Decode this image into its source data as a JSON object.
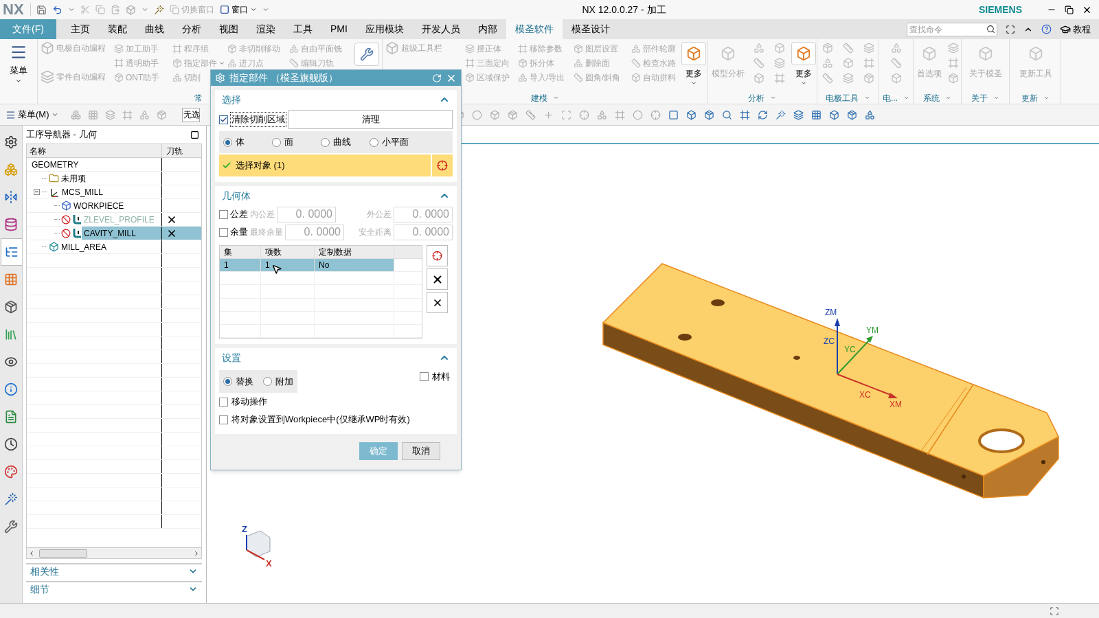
{
  "title_bar": {
    "logo": "NX",
    "switch_window": "切换窗口",
    "window_menu": "窗口",
    "title": "NX 12.0.0.27 - 加工",
    "brand": "SIEMENS"
  },
  "menu_tabs": {
    "file": "文件(F)",
    "tabs": [
      {
        "label": "主页",
        "selected": false
      },
      {
        "label": "装配",
        "selected": false
      },
      {
        "label": "曲线",
        "selected": false
      },
      {
        "label": "分析",
        "selected": false
      },
      {
        "label": "视图",
        "selected": false
      },
      {
        "label": "渲染",
        "selected": false
      },
      {
        "label": "工具",
        "selected": false
      },
      {
        "label": "PMI",
        "selected": false
      },
      {
        "label": "应用模块",
        "selected": false
      },
      {
        "label": "开发人员",
        "selected": false
      },
      {
        "label": "内部",
        "selected": false
      },
      {
        "label": "模圣软件",
        "selected": true
      },
      {
        "label": "模圣设计",
        "selected": false
      }
    ],
    "search_placeholder": "查找命令",
    "tutorial": "教程"
  },
  "ribbon": {
    "menu_button": "菜单",
    "groups": [
      {
        "label": "常",
        "columns": [
          {
            "kind": "medium",
            "items": [
              {
                "label": "电极自动编程",
                "dropdown": false
              },
              {
                "label": "零件自动编程",
                "dropdown": false
              }
            ]
          },
          {
            "kind": "small",
            "items": [
              {
                "label": "加工助手",
                "dropdown": false
              },
              {
                "label": "透明助手",
                "dropdown": false
              },
              {
                "label": "ONT助手",
                "dropdown": false
              }
            ]
          },
          {
            "kind": "small",
            "items": [
              {
                "label": "程序组",
                "dropdown": false
              },
              {
                "label": "指定部件",
                "dropdown": true
              },
              {
                "label": "切削",
                "dropdown": false
              }
            ]
          },
          {
            "kind": "small",
            "items": [
              {
                "label": "非切削移动",
                "dropdown": false
              },
              {
                "label": "进刀点",
                "dropdown": false
              }
            ]
          },
          {
            "kind": "small",
            "items": [
              {
                "label": "自由平面铣",
                "dropdown": false
              },
              {
                "label": "编辑刀轨",
                "dropdown": false
              }
            ]
          },
          {
            "kind": "large_icon"
          }
        ]
      },
      {
        "label": "建模",
        "columns": [
          {
            "kind": "medium",
            "items": [
              {
                "label": "超级工具栏",
                "dropdown": false
              }
            ]
          },
          {
            "kind": "small",
            "items": [
              {
                "label": "摆正体",
                "dropdown": false
              },
              {
                "label": "三面定向",
                "dropdown": false
              },
              {
                "label": "区域保护",
                "dropdown": false
              }
            ]
          },
          {
            "kind": "small",
            "items": [
              {
                "label": "移除参数",
                "dropdown": false
              },
              {
                "label": "拆分体",
                "dropdown": false
              },
              {
                "label": "导入/导出",
                "dropdown": false
              }
            ]
          },
          {
            "kind": "small",
            "items": [
              {
                "label": "图层设置",
                "dropdown": false
              },
              {
                "label": "删除面",
                "dropdown": false
              },
              {
                "label": "圆角/斜角",
                "dropdown": false
              }
            ]
          },
          {
            "kind": "small",
            "items": [
              {
                "label": "部件轮廓",
                "dropdown": false
              },
              {
                "label": "检查水路",
                "dropdown": false
              },
              {
                "label": "自动拼料",
                "dropdown": false
              }
            ]
          },
          {
            "kind": "large",
            "label": "更多",
            "dropdown": true
          }
        ]
      },
      {
        "label": "分析",
        "columns": [
          {
            "kind": "large",
            "label": "模型分析",
            "dropdown": false
          },
          {
            "kind": "icons"
          },
          {
            "kind": "icons"
          },
          {
            "kind": "large",
            "label": "更多",
            "dropdown": true
          }
        ]
      },
      {
        "label": "电极工具",
        "columns": [
          {
            "kind": "icons"
          },
          {
            "kind": "icons"
          },
          {
            "kind": "icons"
          }
        ]
      },
      {
        "label": "电...",
        "columns": [
          {
            "kind": "icons"
          }
        ]
      },
      {
        "label": "系统",
        "columns": [
          {
            "kind": "large",
            "label": "首选项",
            "dropdown": false
          },
          {
            "kind": "icons"
          }
        ]
      },
      {
        "label": "关于",
        "columns": [
          {
            "kind": "large",
            "label": "关于模圣",
            "dropdown": false
          }
        ]
      },
      {
        "label": "更新",
        "columns": [
          {
            "kind": "large",
            "label": "更新工具",
            "dropdown": false
          }
        ]
      }
    ]
  },
  "toolbar": {
    "menu_button": "菜单(M)",
    "combo_value": "无选"
  },
  "resource_bar": [
    {
      "selected": false
    },
    {
      "selected": false
    },
    {
      "selected": false
    },
    {
      "selected": false
    },
    {
      "selected": true
    },
    {
      "selected": false
    },
    {
      "selected": false
    },
    {
      "selected": false
    },
    {
      "selected": false
    },
    {
      "selected": false
    },
    {
      "selected": false
    },
    {
      "selected": false
    },
    {
      "selected": false
    },
    {
      "selected": false
    },
    {
      "selected": false
    }
  ],
  "navigator": {
    "title": "工序导航器 - 几何",
    "columns": [
      "名称",
      "刀轨"
    ],
    "tree": [
      {
        "name": "GEOMETRY",
        "kind": "geometry",
        "selected": false,
        "children": [
          {
            "name": "未用项",
            "kind": "folder",
            "selected": false
          },
          {
            "name": "MCS_MILL",
            "kind": "mcs",
            "selected": false,
            "expanded": true,
            "children": [
              {
                "name": "WORKPIECE",
                "kind": "workpiece",
                "selected": false
              },
              {
                "name": "ZLEVEL_PROFILE",
                "kind": "operation",
                "selected": false,
                "inactive": true,
                "generated": false
              },
              {
                "name": "CAVITY_MILL",
                "kind": "operation",
                "selected": true,
                "inactive": false,
                "generated": false
              }
            ]
          },
          {
            "name": "MILL_AREA",
            "kind": "area",
            "selected": false
          }
        ]
      }
    ],
    "sections": [
      {
        "label": "相关性",
        "expanded": false
      },
      {
        "label": "细节",
        "expanded": false
      }
    ]
  },
  "dialog": {
    "title": "指定部件 （模圣旗舰版）",
    "selection": {
      "title": "选择",
      "expanded": true,
      "clear_area": {
        "label": "清除切削区域",
        "checked": true
      },
      "clear_button": "清理",
      "filters": [
        {
          "label": "体",
          "selected": true
        },
        {
          "label": "面",
          "selected": false
        },
        {
          "label": "曲线",
          "selected": false
        },
        {
          "label": "小平面",
          "selected": false
        }
      ],
      "select_object": {
        "label": "选择对象 (1)",
        "done": true
      }
    },
    "geometry": {
      "title": "几何体",
      "expanded": true,
      "rows": [
        {
          "label": "公差",
          "checked": false,
          "fields": [
            {
              "label": "内公差",
              "value": "0. 0000"
            },
            {
              "label": "外公差",
              "value": "0. 0000"
            }
          ]
        },
        {
          "label": "余量",
          "checked": false,
          "fields": [
            {
              "label": "最终余量",
              "value": "0. 0000"
            },
            {
              "label": "安全距离",
              "value": "0. 0000"
            }
          ]
        }
      ],
      "table": {
        "columns": [
          "集",
          "项数",
          "定制数据"
        ],
        "rows": [
          {
            "cells": [
              "1",
              "1",
              "No"
            ],
            "selected": true
          }
        ]
      }
    },
    "settings": {
      "title": "设置",
      "expanded": true,
      "modes": [
        {
          "label": "替换",
          "selected": true
        },
        {
          "label": "附加",
          "selected": false
        }
      ],
      "material": {
        "label": "材料",
        "checked": false
      },
      "options": [
        {
          "label": "移动操作",
          "checked": false
        },
        {
          "label": "将对象设置到Workpiece中(仅继承WP时有效)",
          "checked": false
        }
      ]
    },
    "ok": "确定",
    "cancel": "取消"
  },
  "viewport": {
    "axis_labels": [
      {
        "text": "ZM",
        "color": "#1c3fae"
      },
      {
        "text": "YM",
        "color": "#2f9a2f"
      },
      {
        "text": "ZC",
        "color": "#1c3fae"
      },
      {
        "text": "YC",
        "color": "#2f9a2f"
      },
      {
        "text": "XC",
        "color": "#c8322a"
      },
      {
        "text": "XM",
        "color": "#c8322a"
      }
    ],
    "triad_labels": [
      {
        "text": "Z",
        "color": "#1c3fae"
      },
      {
        "text": "X",
        "color": "#c8322a"
      }
    ]
  }
}
